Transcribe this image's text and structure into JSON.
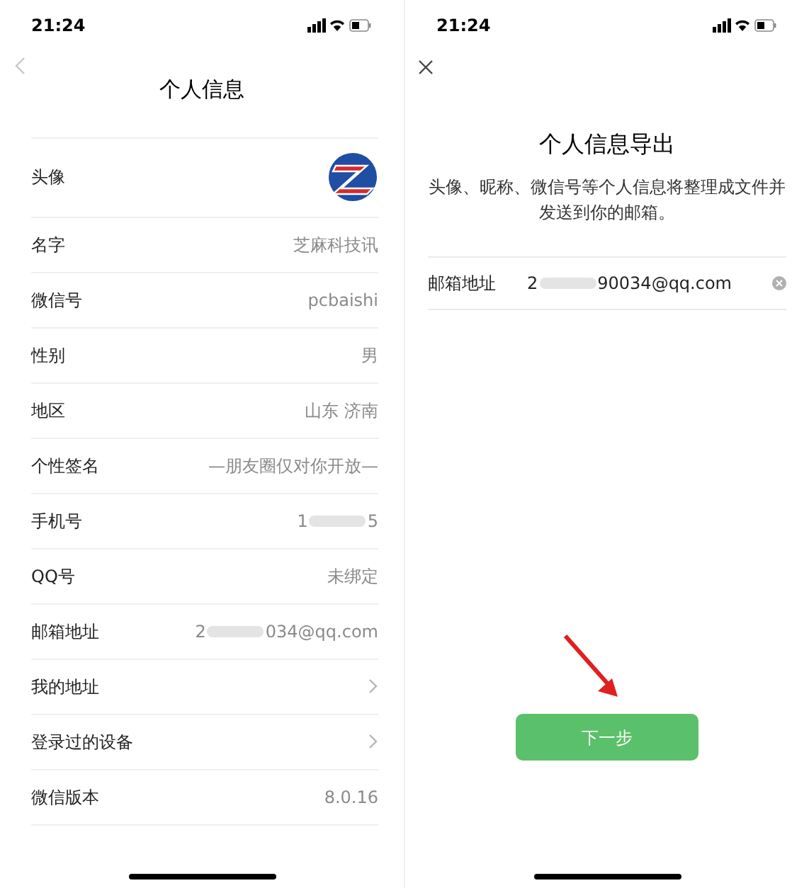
{
  "screens": [
    {
      "status_bar": {
        "time": "21:24"
      },
      "title": "个人信息",
      "rows": [
        {
          "kind": "avatar",
          "label": "头像"
        },
        {
          "kind": "text",
          "label": "名字",
          "value": "芝麻科技讯"
        },
        {
          "kind": "text",
          "label": "微信号",
          "value": "pcbaishi"
        },
        {
          "kind": "text",
          "label": "性别",
          "value": "男"
        },
        {
          "kind": "text",
          "label": "地区",
          "value": "山东 济南"
        },
        {
          "kind": "text",
          "label": "个性签名",
          "value": "—朋友圈仅对你开放—"
        },
        {
          "kind": "masked",
          "label": "手机号",
          "value_start": "1",
          "value_end": "5"
        },
        {
          "kind": "text",
          "label": "QQ号",
          "value": "未绑定"
        },
        {
          "kind": "masked",
          "label": "邮箱地址",
          "value_start": "2",
          "value_end": "034@qq.com"
        },
        {
          "kind": "link",
          "label": "我的地址"
        },
        {
          "kind": "link",
          "label": "登录过的设备"
        },
        {
          "kind": "text",
          "label": "微信版本",
          "value": "8.0.16"
        }
      ]
    },
    {
      "status_bar": {
        "time": "21:24"
      },
      "title": "个人信息导出",
      "description": "头像、昵称、微信号等个人信息将整理成文件并发送到你的邮箱。",
      "email_field": {
        "label": "邮箱地址",
        "value_start": "2",
        "value_end": "90034@qq.com"
      },
      "button": "下一步"
    }
  ]
}
